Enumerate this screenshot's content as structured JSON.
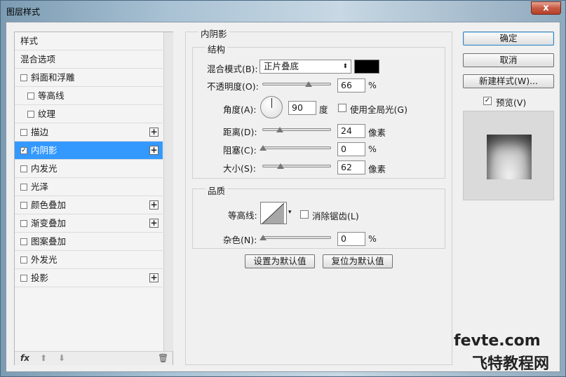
{
  "window": {
    "title": "图层样式",
    "close_glyph": "x"
  },
  "style_list": {
    "items": [
      {
        "label": "样式",
        "checkbox": false,
        "checked": false,
        "indent": false,
        "plus": false,
        "selected": false
      },
      {
        "label": "混合选项",
        "checkbox": false,
        "checked": false,
        "indent": false,
        "plus": false,
        "selected": false
      },
      {
        "label": "斜面和浮雕",
        "checkbox": true,
        "checked": false,
        "indent": false,
        "plus": false,
        "selected": false
      },
      {
        "label": "等高线",
        "checkbox": true,
        "checked": false,
        "indent": true,
        "plus": false,
        "selected": false
      },
      {
        "label": "纹理",
        "checkbox": true,
        "checked": false,
        "indent": true,
        "plus": false,
        "selected": false
      },
      {
        "label": "描边",
        "checkbox": true,
        "checked": false,
        "indent": false,
        "plus": true,
        "selected": false
      },
      {
        "label": "内阴影",
        "checkbox": true,
        "checked": true,
        "indent": false,
        "plus": true,
        "selected": true
      },
      {
        "label": "内发光",
        "checkbox": true,
        "checked": false,
        "indent": false,
        "plus": false,
        "selected": false
      },
      {
        "label": "光泽",
        "checkbox": true,
        "checked": false,
        "indent": false,
        "plus": false,
        "selected": false
      },
      {
        "label": "颜色叠加",
        "checkbox": true,
        "checked": false,
        "indent": false,
        "plus": true,
        "selected": false
      },
      {
        "label": "渐变叠加",
        "checkbox": true,
        "checked": false,
        "indent": false,
        "plus": true,
        "selected": false
      },
      {
        "label": "图案叠加",
        "checkbox": true,
        "checked": false,
        "indent": false,
        "plus": false,
        "selected": false
      },
      {
        "label": "外发光",
        "checkbox": true,
        "checked": false,
        "indent": false,
        "plus": false,
        "selected": false
      },
      {
        "label": "投影",
        "checkbox": true,
        "checked": false,
        "indent": false,
        "plus": true,
        "selected": false
      }
    ],
    "plus_glyph": "+",
    "check_glyph": "✓",
    "footer": {
      "fx_label": "fx",
      "up_glyph": "⬆",
      "down_glyph": "⬇",
      "trash_glyph": "🗑"
    }
  },
  "panel": {
    "title": "内阴影",
    "structure": {
      "title": "结构",
      "blend_mode_label": "混合模式(B):",
      "blend_mode_value": "正片叠底",
      "select_arrow": "⬍",
      "shadow_color": "#000000",
      "opacity_label": "不透明度(O):",
      "opacity_value": "66",
      "opacity_fraction": 0.66,
      "percent_unit": "%",
      "angle_label": "角度(A):",
      "angle_value": "90",
      "angle_unit": "度",
      "global_light_label": "使用全局光(G)",
      "global_light_checked": false,
      "distance_label": "距离(D):",
      "distance_value": "24",
      "distance_fraction": 0.24,
      "pixel_unit": "像素",
      "choke_label": "阻塞(C):",
      "choke_value": "0",
      "choke_fraction": 0.0,
      "size_label": "大小(S):",
      "size_value": "62",
      "size_fraction": 0.25
    },
    "quality": {
      "title": "品质",
      "contour_label": "等高线:",
      "contour_arrow": "▾",
      "antialias_label": "消除锯齿(L)",
      "antialias_checked": false,
      "noise_label": "杂色(N):",
      "noise_value": "0",
      "noise_fraction": 0.0,
      "percent_unit": "%"
    },
    "set_default_button": "设置为默认值",
    "reset_default_button": "复位为默认值"
  },
  "actions": {
    "ok": "确定",
    "cancel": "取消",
    "new_style": "新建样式(W)...",
    "preview_label": "预览(V)",
    "preview_checked": true
  },
  "watermark": {
    "top": "fevte.com",
    "bottom": "飞特教程网"
  },
  "colors": {
    "selected_bg": "#3399ff",
    "window_bg": "#f0f0f0",
    "close_red": "#c75a43"
  }
}
